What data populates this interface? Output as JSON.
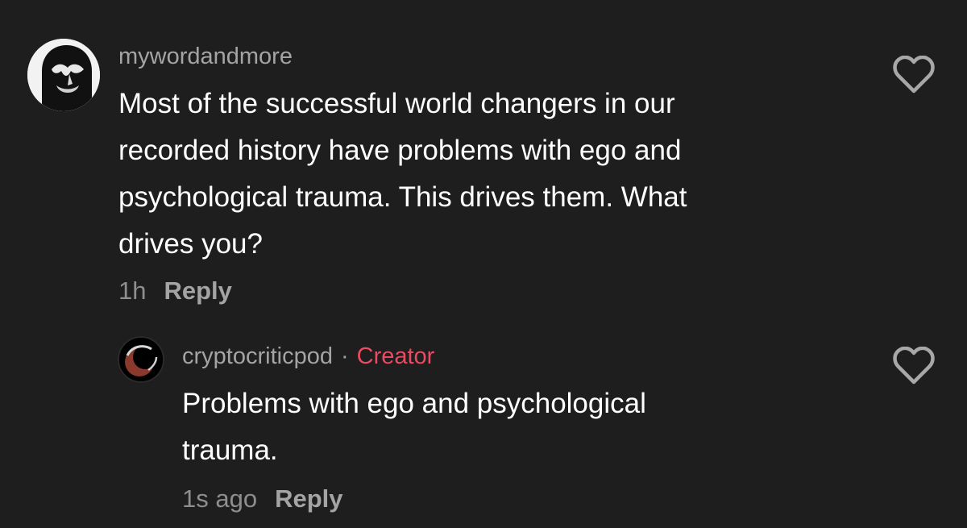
{
  "comments": [
    {
      "username": "mywordandmore",
      "text_lines": [
        "Most of the successful world changers in our",
        "recorded history have problems with ego and",
        "psychological trauma. This drives them. What",
        "drives you?"
      ],
      "time": "1h",
      "reply_label": "Reply",
      "avatar_icon": "user-avatar-face",
      "like_icon": "heart-outline-icon"
    },
    {
      "username": "cryptocriticpod",
      "separator": "·",
      "badge": "Creator",
      "text_lines": [
        "Problems with ego and psychological",
        "trauma."
      ],
      "time": "1s ago",
      "reply_label": "Reply",
      "avatar_icon": "moon-avatar",
      "like_icon": "heart-outline-icon"
    }
  ],
  "colors": {
    "background": "#1e1e1e",
    "username": "#a4a4a4",
    "body_text": "#ffffff",
    "creator_badge": "#ec4a61",
    "timestamp": "#8e8e8e"
  }
}
